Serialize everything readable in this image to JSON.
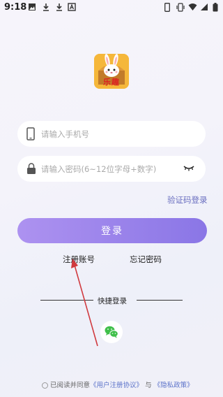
{
  "status_bar": {
    "time": "9:18"
  },
  "logo": {
    "text": "乐趣"
  },
  "form": {
    "phone_placeholder": "请输入手机号",
    "password_placeholder": "请输入密码(6~12位字母+数字)",
    "verify_code_login": "验证码登录",
    "login_button": "登录",
    "register": "注册账号",
    "forgot_password": "忘记密码"
  },
  "quick_login": {
    "label": "快捷登录"
  },
  "agreement": {
    "prefix": "已阅读并同意",
    "user_agreement": "《用户注册协议》",
    "and": "与",
    "privacy_policy": "《隐私政策》"
  },
  "colors": {
    "accent": "#8a76e6",
    "link": "#6a6fc0",
    "wechat": "#3fbf4a",
    "annotation_arrow": "#d0393e"
  }
}
